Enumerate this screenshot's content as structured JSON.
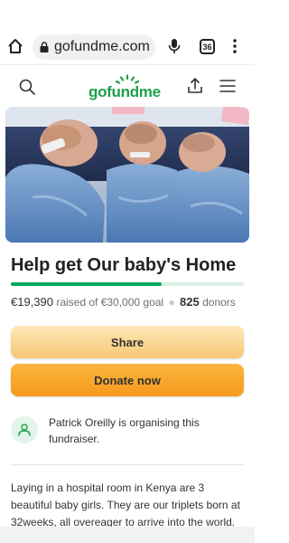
{
  "browser": {
    "url": "gofundme.com",
    "tab_count": "36"
  },
  "header": {
    "logo_text": "gofundme"
  },
  "campaign": {
    "title": "Help get Our baby's Home",
    "raised": "€19,390",
    "raised_suffix": "raised of €30,000 goal",
    "donor_count": "825",
    "donors_label": "donors",
    "progress_fraction": 0.6463
  },
  "actions": {
    "share_label": "Share",
    "donate_label": "Donate now"
  },
  "organiser": {
    "text": "Patrick Oreilly is organising this fundraiser."
  },
  "story": {
    "text": "Laying in a hospital room in Kenya are 3 beautiful baby girls. They are our triplets born at 32weeks, all overeager to arrive into the world."
  },
  "colors": {
    "brand_green": "#02a95c",
    "share_button": "#f8c774",
    "donate_button": "#f69a1c"
  },
  "icons": {
    "home": "home-icon",
    "lock": "lock-icon",
    "mic": "microphone-icon",
    "tabs": "tabs-icon",
    "more": "kebab-menu-icon",
    "search": "search-icon",
    "share": "share-upload-icon",
    "menu": "hamburger-menu-icon",
    "organiser": "organiser-person-icon"
  }
}
